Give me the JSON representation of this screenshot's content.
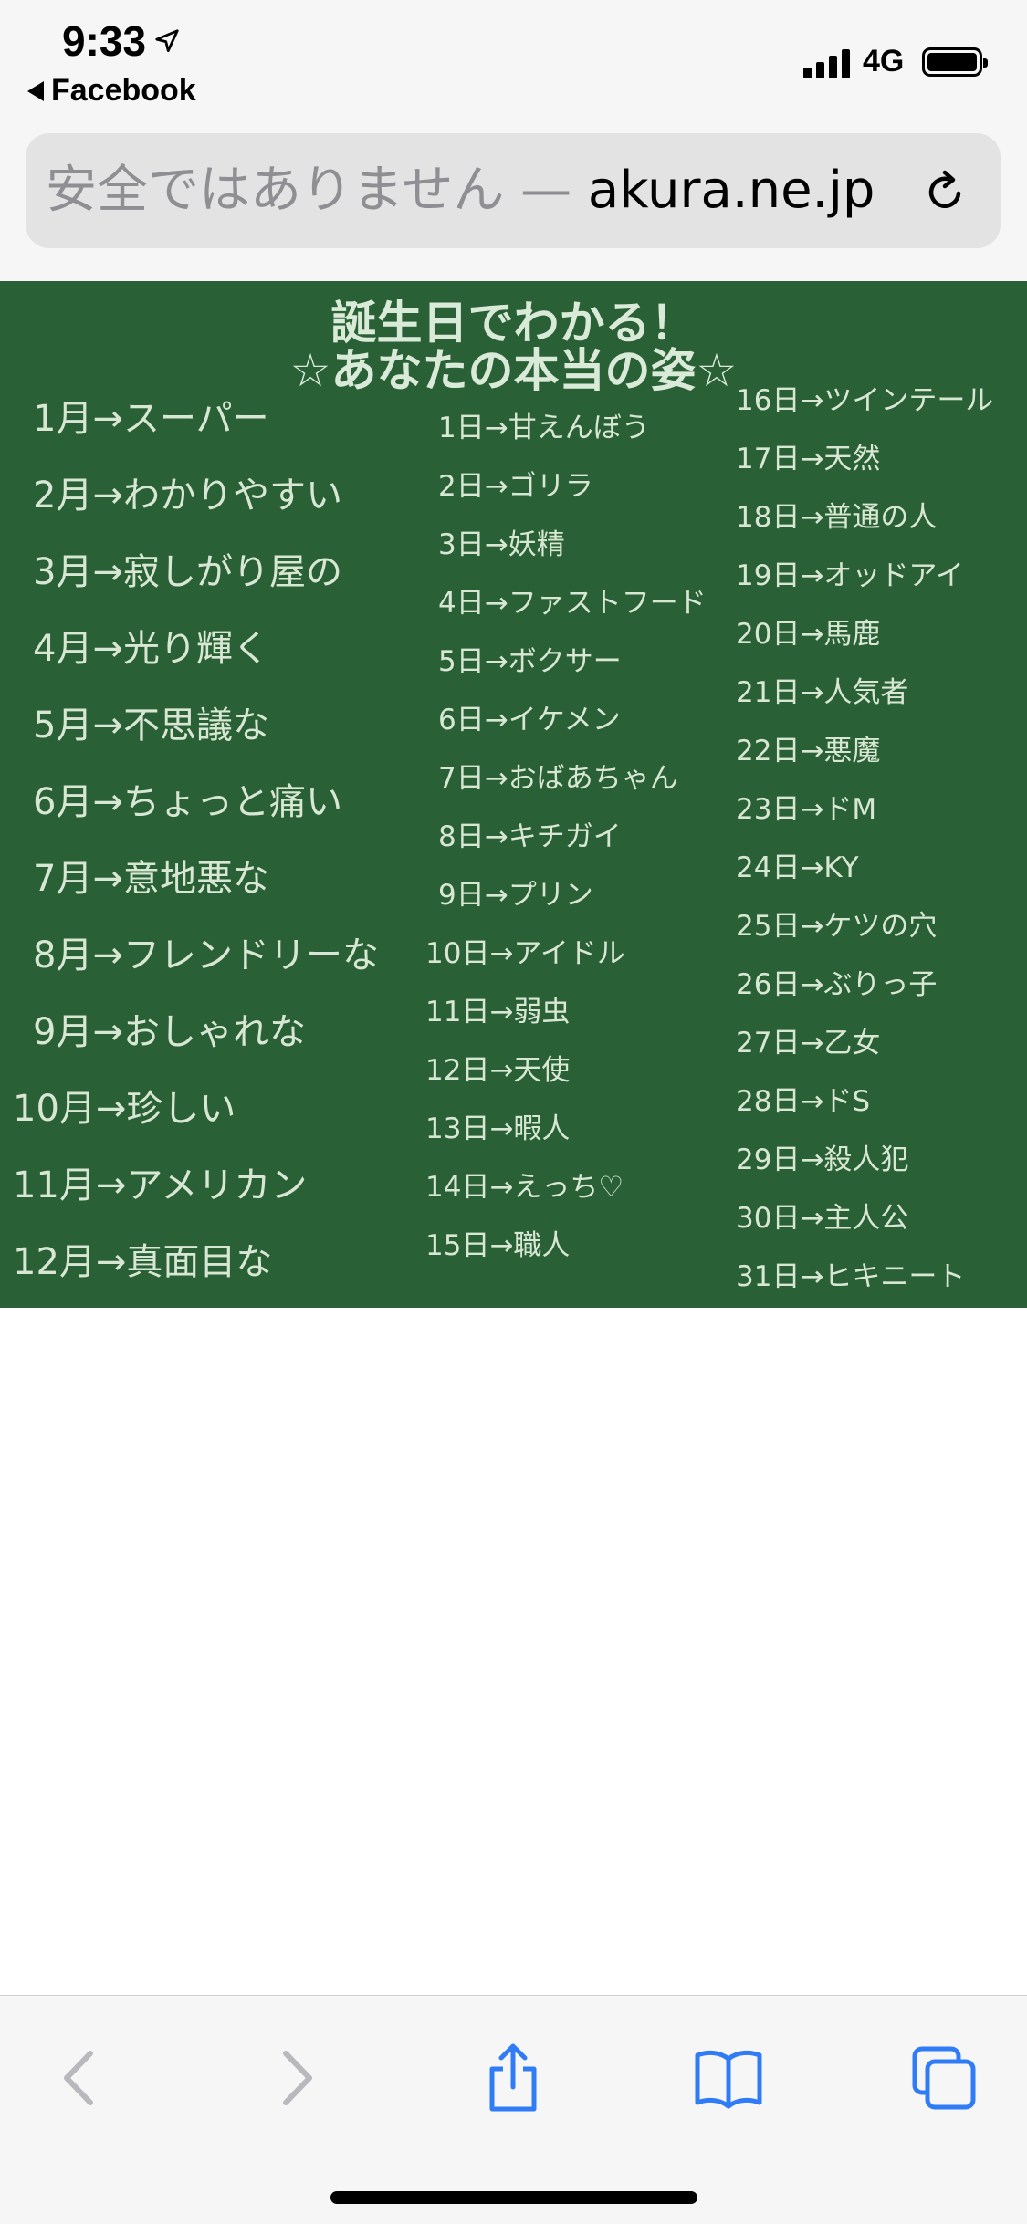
{
  "status_bar": {
    "time": "9:33",
    "back_app": "Facebook",
    "network": "4G",
    "icons": [
      "location-arrow-icon",
      "signal-icon",
      "battery-icon"
    ]
  },
  "address_bar": {
    "warning": "安全ではありません — ",
    "host": "akura.ne.jp",
    "reload_icon": "reload-icon"
  },
  "board": {
    "title_line1": "誕生日でわかる！",
    "title_line2": "☆あなたの本当の姿☆",
    "months": [
      "1月→スーパー",
      "2月→わかりやすい",
      "3月→寂しがり屋の",
      "4月→光り輝く",
      "5月→不思議な",
      "6月→ちょっと痛い",
      "7月→意地悪な",
      "8月→フレンドリーな",
      "9月→おしゃれな",
      "10月→珍しい",
      "11月→アメリカン",
      "12月→真面目な"
    ],
    "days_col1": [
      "1日→甘えんぼう",
      "2日→ゴリラ",
      "3日→妖精",
      "4日→ファストフード",
      "5日→ボクサー",
      "6日→イケメン",
      "7日→おばあちゃん",
      "8日→キチガイ",
      "9日→プリン",
      "10日→アイドル",
      "11日→弱虫",
      "12日→天使",
      "13日→暇人",
      "14日→えっち♡",
      "15日→職人"
    ],
    "days_col2": [
      "16日→ツインテール",
      "17日→天然",
      "18日→普通の人",
      "19日→オッドアイ",
      "20日→馬鹿",
      "21日→人気者",
      "22日→悪魔",
      "23日→ドM",
      "24日→KY",
      "25日→ケツの穴",
      "26日→ぶりっ子",
      "27日→乙女",
      "28日→ドS",
      "29日→殺人犯",
      "30日→主人公",
      "31日→ヒキニート"
    ]
  },
  "toolbar": {
    "icons": [
      "back-chevron-icon",
      "forward-chevron-icon",
      "share-icon",
      "bookmarks-icon",
      "tabs-icon"
    ]
  },
  "colors": {
    "board_bg": "#2a6036",
    "chalk": "#d8e7d4",
    "ios_blue": "#2f7cf6",
    "disabled_gray": "#b8b8bd"
  }
}
